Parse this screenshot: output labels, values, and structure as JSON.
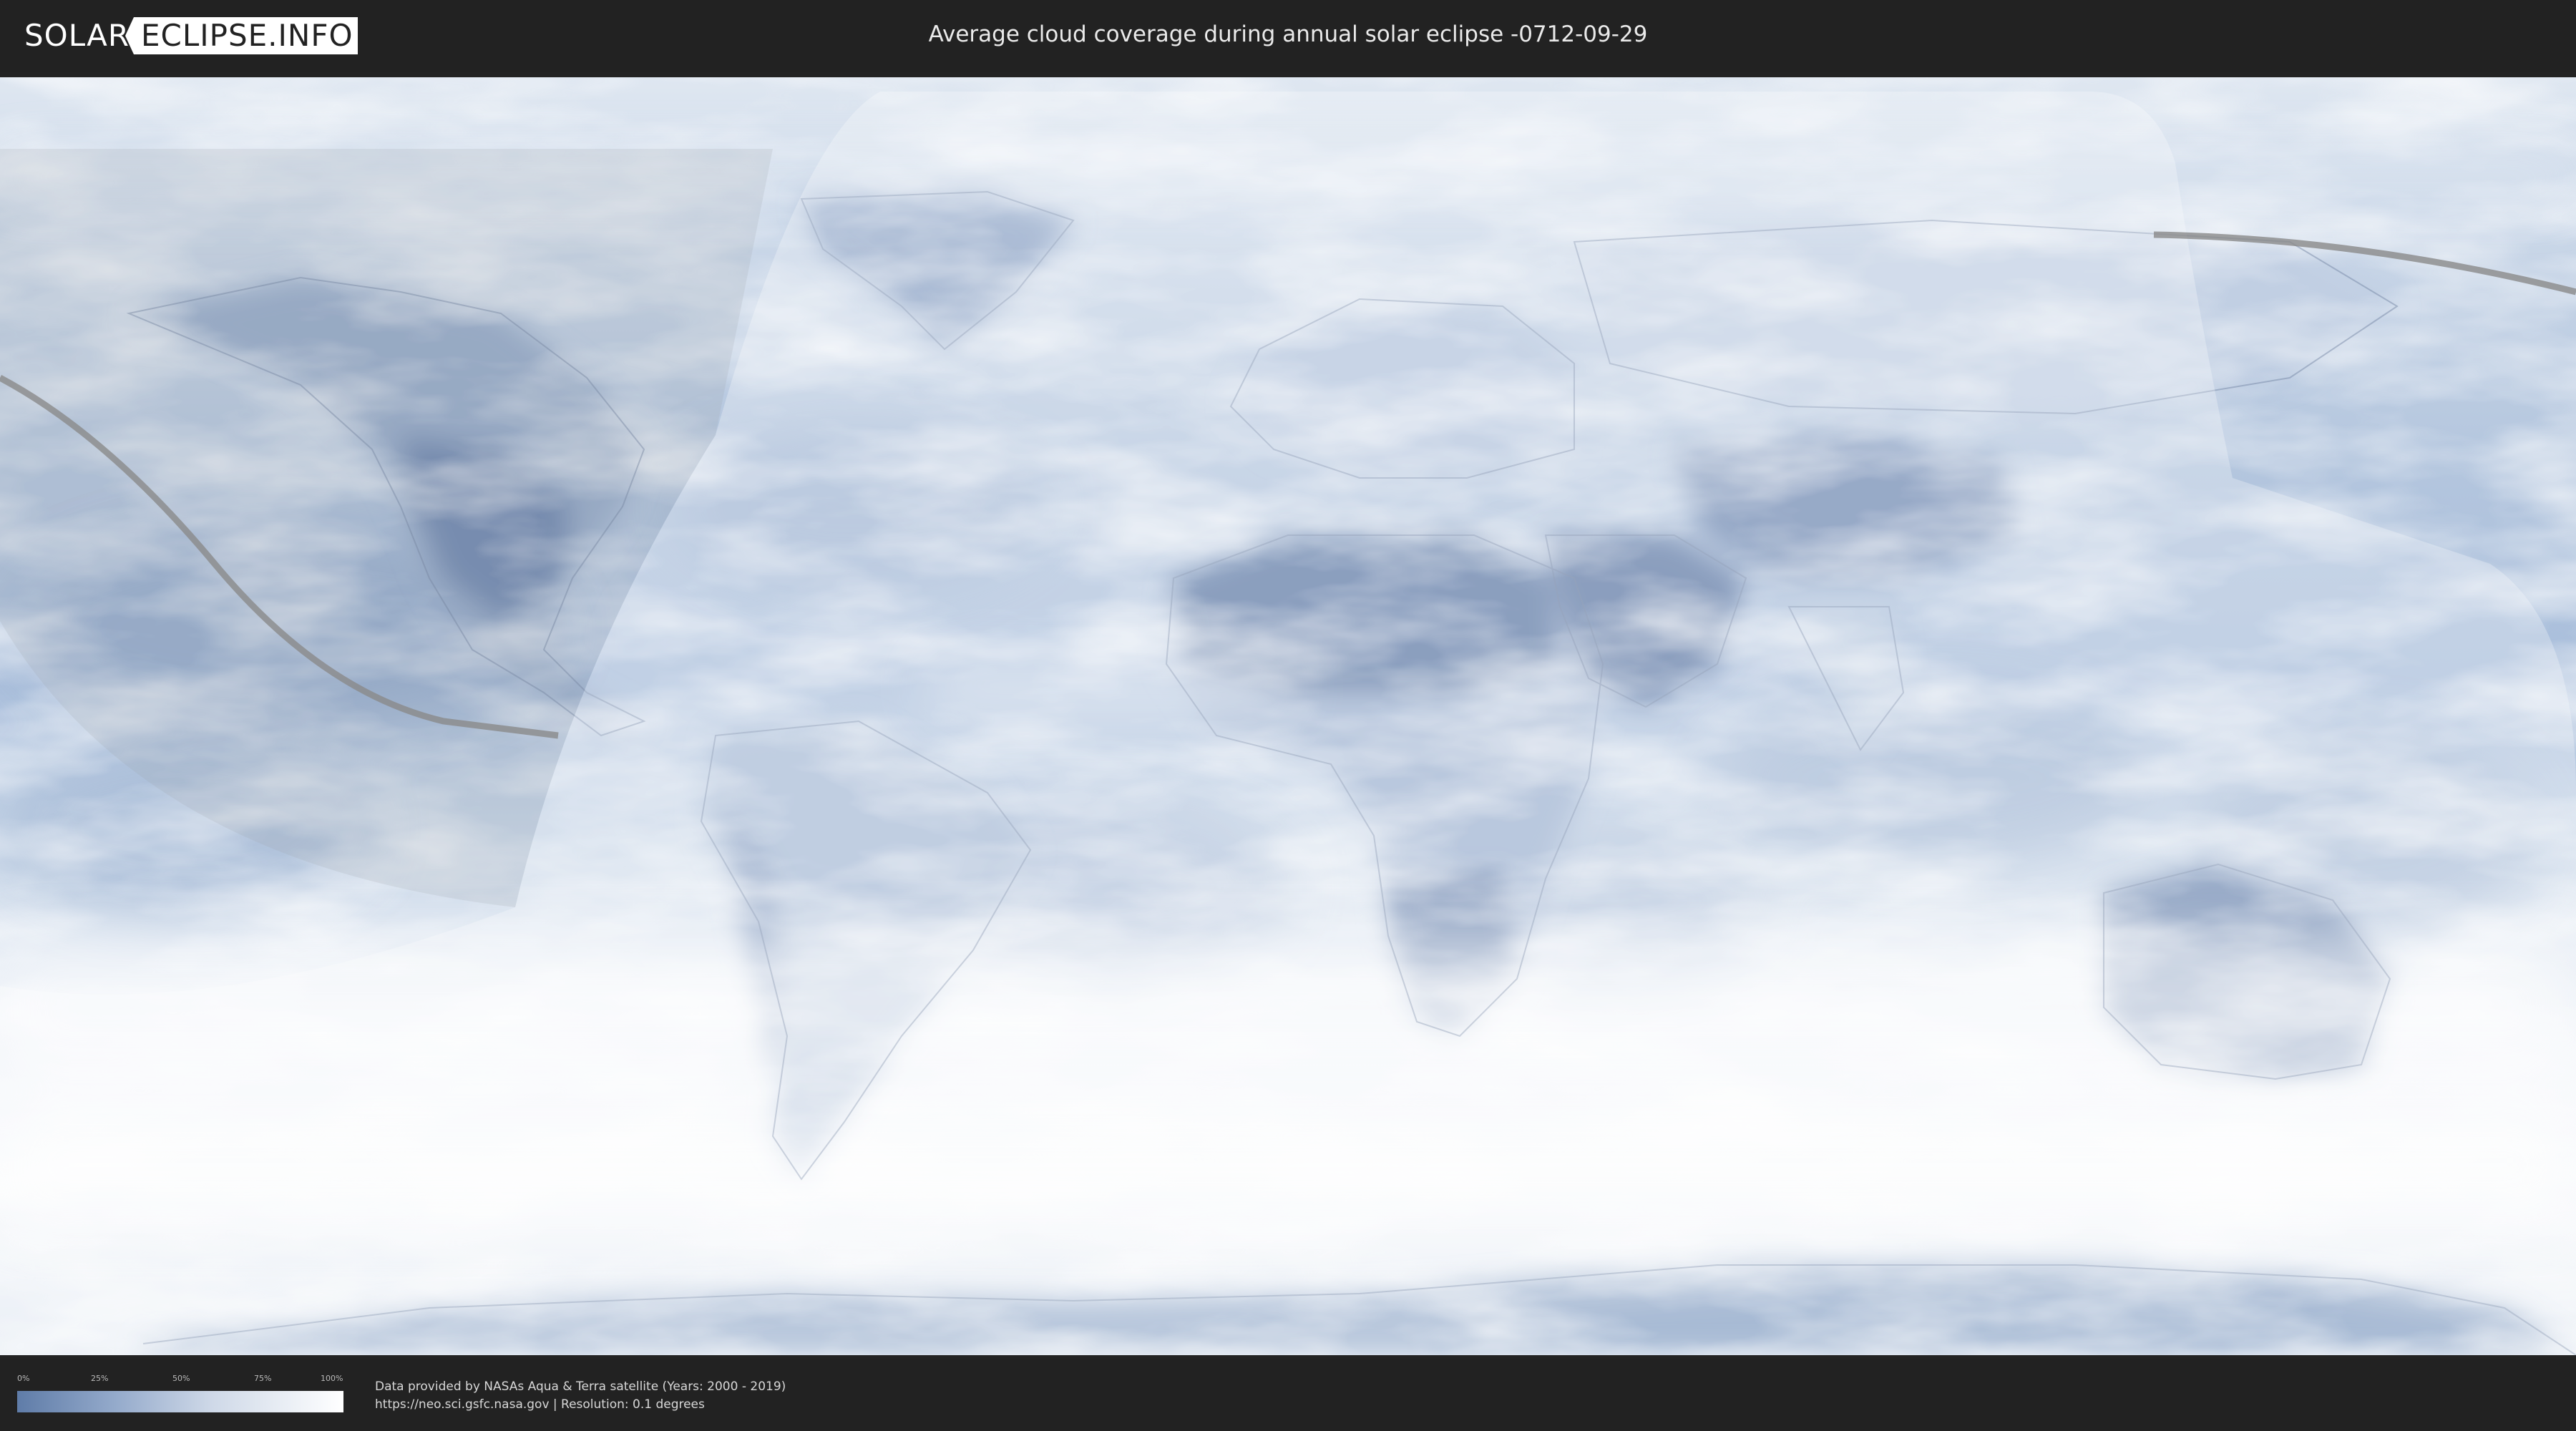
{
  "header": {
    "logo_left": "SOLAR",
    "logo_right": "ECLIPSE.INFO",
    "title": "Average cloud coverage during annual solar eclipse -0712-09-29"
  },
  "map": {
    "colors": {
      "ocean_clear": "#8fa8cb",
      "cloud": "#f4f7fb",
      "land_clear": "#5f7aa5",
      "eclipse_band": "#ffffff",
      "path_line": "#8a8a8a"
    }
  },
  "legend": {
    "ticks": [
      "0%",
      "25%",
      "50%",
      "75%",
      "100%"
    ],
    "gradient": [
      "#5f7ca8",
      "#ffffff"
    ]
  },
  "footer": {
    "credit_line1": "Data provided by NASAs Aqua & Terra satellite (Years: 2000 - 2019)",
    "credit_line2": "https://neo.sci.gsfc.nasa.gov | Resolution: 0.1 degrees"
  }
}
